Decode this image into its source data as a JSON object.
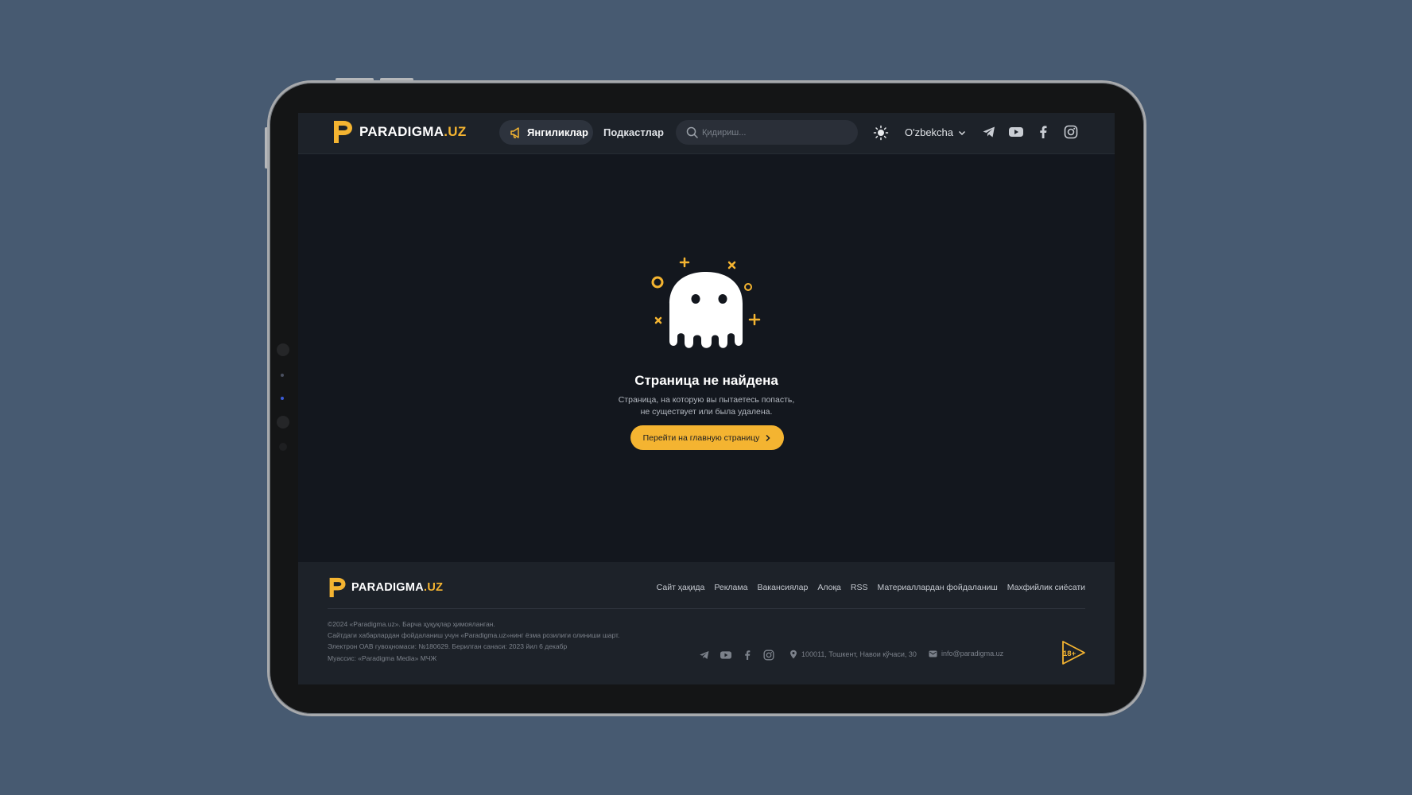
{
  "brand": {
    "name_main": "PARADIGMA",
    "name_suffix": ".UZ",
    "accent": "#f4b431"
  },
  "header": {
    "nav_active": {
      "label": "Янгиликлар",
      "icon": "megaphone-icon"
    },
    "nav_link": "Подкастлар",
    "search_placeholder": "Қидириш...",
    "theme_icon": "sun-icon",
    "language": "O'zbekcha",
    "socials": [
      "telegram-icon",
      "youtube-icon",
      "facebook-icon",
      "instagram-icon"
    ]
  },
  "error_page": {
    "illustration": "ghost-icon",
    "title": "Страница не найдена",
    "description_line1": "Страница, на которую вы пытаетесь попасть,",
    "description_line2": "не существует или была удалена.",
    "button_label": "Перейти на главную страницу"
  },
  "footer": {
    "links": [
      "Сайт ҳақида",
      "Реклама",
      "Вакансиялар",
      "Алоқа",
      "RSS",
      "Материаллардан фойдаланиш",
      "Махфийлик сиёсати"
    ],
    "legal": [
      "©2024 «Paradigma.uz». Барча ҳуқуқлар ҳимояланган.",
      "Сайтдаги хабарлардан фойдаланиш учун «Paradigma.uz»нинг ёзма розилиги олиниши шарт.",
      "Электрон ОАВ гувоҳномаси: №180629. Берилган санаси: 2023 йил 6 декабр",
      "Муассис: «Paradigma Media» МЧЖ"
    ],
    "address": "100011, Тошкент, Навои кўчаси, 30",
    "email": "info@paradigma.uz",
    "age_rating": "18+"
  }
}
